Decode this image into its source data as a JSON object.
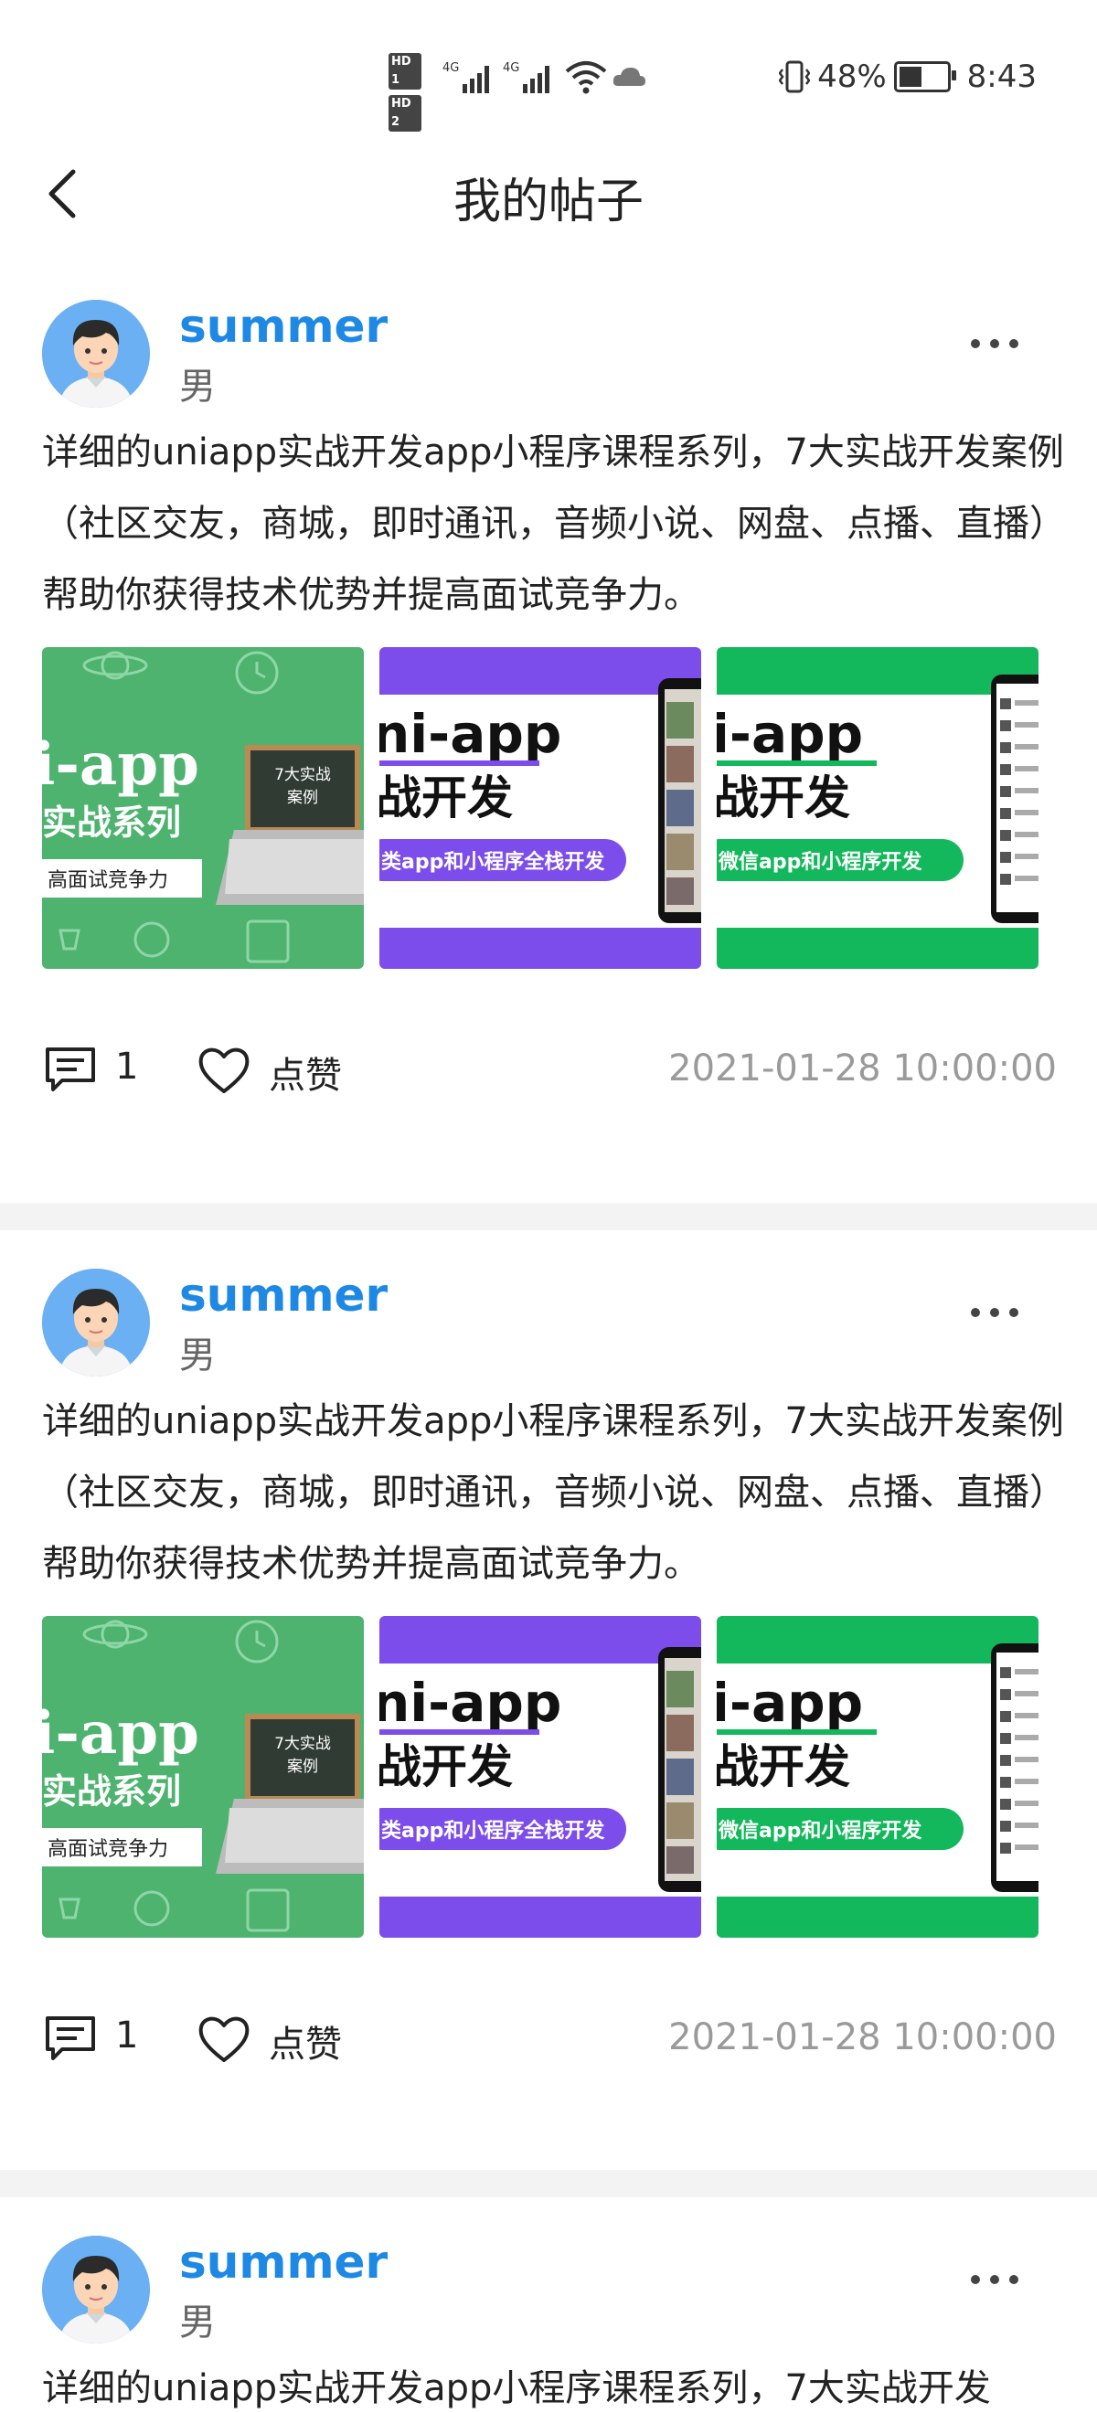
{
  "status_bar": {
    "hd1": "HD 1",
    "hd2": "HD 2",
    "net1": "4G",
    "net2": "4G",
    "battery": "48%",
    "time": "8:43"
  },
  "nav": {
    "title": "我的帖子",
    "back_icon": "chevron-left-icon"
  },
  "posts": [
    {
      "username": "summer",
      "gender": "男",
      "content": "详细的uniapp实战开发app小程序课程系列，7大实战开发案例（社区交友，商城，即时通讯，音频小说、网盘、点播、直播）帮助你获得技术优势并提高面试竞争力。",
      "images": [
        {
          "line1": "i-app",
          "line2": "实战系列",
          "line3": "高面试竞争力",
          "board1": "7大实战",
          "board2": "案例"
        },
        {
          "line1": "ni-app",
          "line2": "战开发",
          "line3": "类app和小程序全栈开发"
        },
        {
          "line1": "i-app",
          "line2": "战开发",
          "line3": "微信app和小程序开发"
        }
      ],
      "comment_count": "1",
      "like_label": "点赞",
      "time": "2021-01-28 10:00:00"
    },
    {
      "username": "summer",
      "gender": "男",
      "content": "详细的uniapp实战开发app小程序课程系列，7大实战开发案例（社区交友，商城，即时通讯，音频小说、网盘、点播、直播）帮助你获得技术优势并提高面试竞争力。",
      "images": [
        {
          "line1": "i-app",
          "line2": "实战系列",
          "line3": "高面试竞争力",
          "board1": "7大实战",
          "board2": "案例"
        },
        {
          "line1": "ni-app",
          "line2": "战开发",
          "line3": "类app和小程序全栈开发"
        },
        {
          "line1": "i-app",
          "line2": "战开发",
          "line3": "微信app和小程序开发"
        }
      ],
      "comment_count": "1",
      "like_label": "点赞",
      "time": "2021-01-28 10:00:00"
    },
    {
      "username": "summer",
      "gender": "男",
      "content": "详细的uniapp实战开发app小程序课程系列，7大实战开发"
    }
  ],
  "colors": {
    "username": "#1e88e5",
    "green": "#4db36f",
    "purple": "#7c4dea",
    "bright_green": "#12b85b"
  }
}
